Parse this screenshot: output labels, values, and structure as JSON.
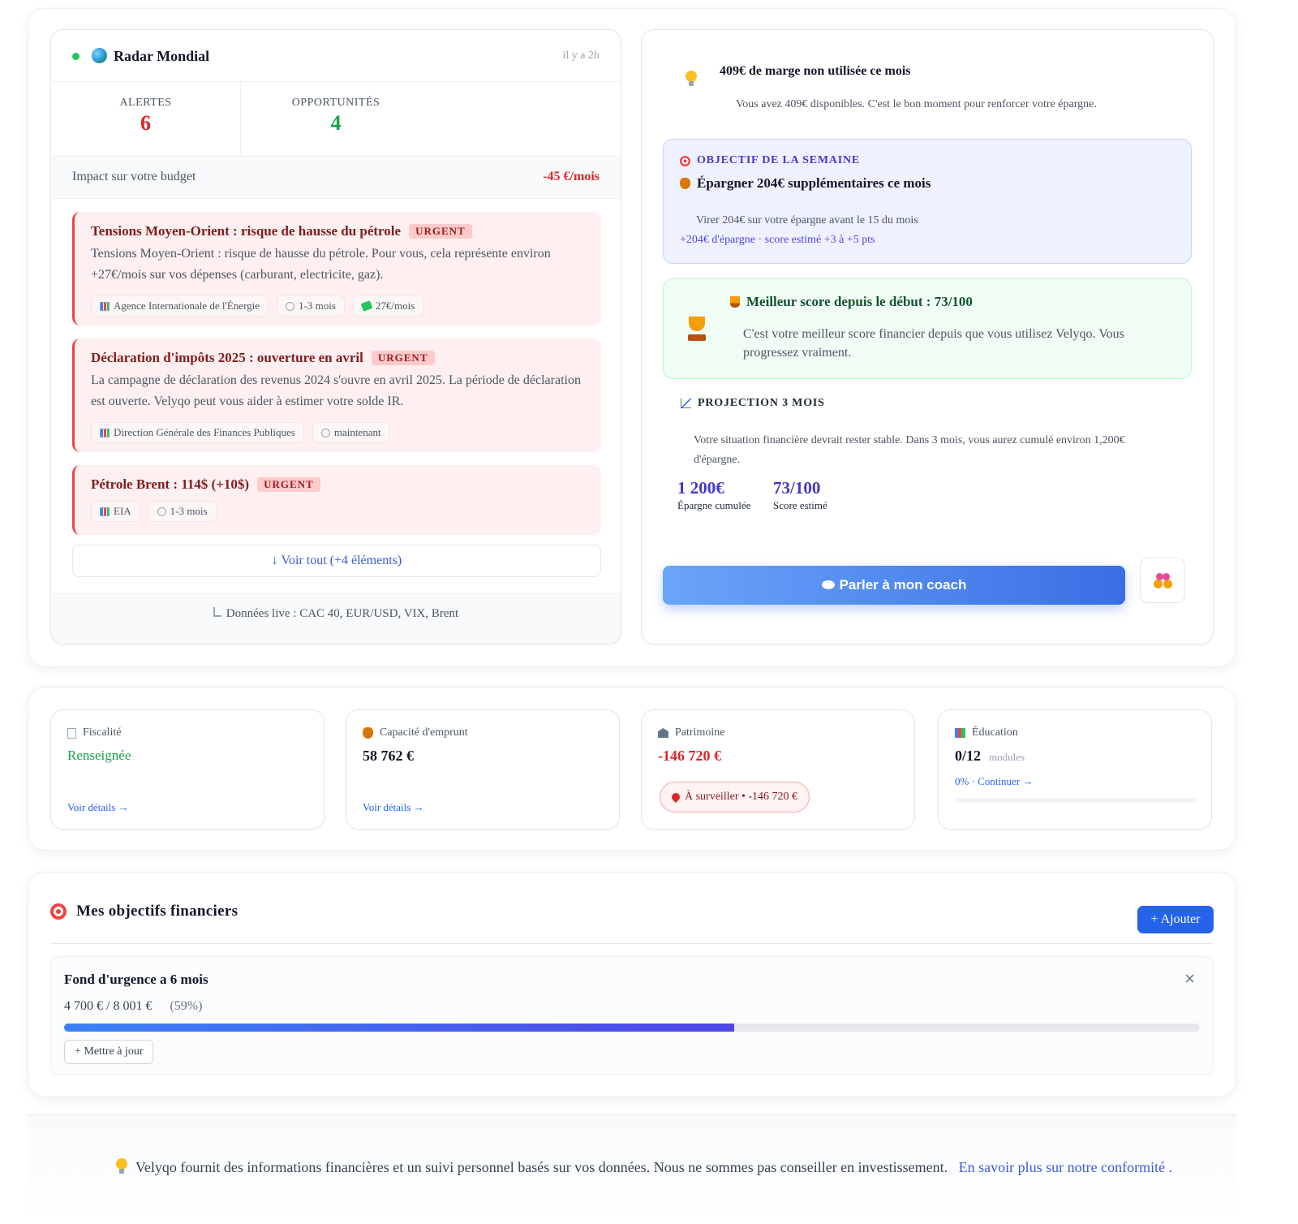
{
  "radar": {
    "title": "Radar Mondial",
    "time": "il y a 2h",
    "alerts_label": "ALERTES",
    "alerts_count": "6",
    "opps_label": "OPPORTUNITÉS",
    "opps_count": "4",
    "impact_label": "Impact sur votre budget",
    "impact_value": "-45 €/mois",
    "items": [
      {
        "title": "Tensions Moyen-Orient : risque de hausse du pétrole",
        "badge": "URGENT",
        "text": "Tensions Moyen-Orient : risque de hausse du pétrole. Pour vous, cela représente environ +27€/mois sur vos dépenses (carburant, electricite, gaz).",
        "source": "Agence Internationale de l'Énergie",
        "horizon": "1-3 mois",
        "amount": "27€/mois"
      },
      {
        "title": "Déclaration d'impôts 2025 : ouverture en avril",
        "badge": "URGENT",
        "text": "La campagne de déclaration des revenus 2024 s'ouvre en avril 2025. La période de déclaration est ouverte. Velyqo peut vous aider à estimer votre solde IR.",
        "source": "Direction Générale des Finances Publiques",
        "horizon": "maintenant"
      },
      {
        "title": "Pétrole Brent : 114$ (+10$)",
        "badge": "URGENT",
        "source": "EIA",
        "horizon": "1-3 mois"
      }
    ],
    "see_all": "↓ Voir tout (+4 éléments)",
    "live": "Données live : CAC 40, EUR/USD, VIX, Brent"
  },
  "coach": {
    "marge_title": "409€ de marge non utilisée ce mois",
    "marge_text": "Vous avez 409€ disponibles. C'est le bon moment pour renforcer votre épargne.",
    "objective_label": "OBJECTIF DE LA SEMAINE",
    "objective_title": "Épargner 204€ supplémentaires ce mois",
    "objective_text": "Virer 204€ sur votre épargne avant le 15 du mois",
    "objective_sub": "+204€ d'épargne · score estimé +3 à +5 pts",
    "best_title": "Meilleur score depuis le début : 73/100",
    "best_text": "C'est votre meilleur score financier depuis que vous utilisez Velyqo. Vous progressez vraiment.",
    "projection_label": "PROJECTION 3 MOIS",
    "projection_text": "Votre situation financière devrait rester stable. Dans 3 mois, vous aurez cumulé environ 1,200€ d'épargne.",
    "savings_value": "1 200€",
    "savings_label": "Épargne cumulée",
    "score_value": "73/100",
    "score_label": "Score estimé",
    "button_label": "Parler à mon coach"
  },
  "summary": {
    "fiscal_label": "Fiscalité",
    "fiscal_value": "Renseignée",
    "fiscal_link": "Voir détails →",
    "borrow_label": "Capacité d'emprunt",
    "borrow_value": "58 762 €",
    "borrow_link": "Voir détails →",
    "wealth_label": "Patrimoine",
    "wealth_value": "-146 720 €",
    "wealth_badge": "À surveiller • -146 720 €",
    "edu_label": "Éducation",
    "edu_value": "0/12",
    "edu_unit": "modules",
    "edu_link": "0% · Continuer →",
    "edu_progress": 0
  },
  "goals": {
    "title": "Mes objectifs financiers",
    "add_label": "+ Ajouter",
    "items": [
      {
        "name": "Fond d'urgence a 6 mois",
        "amount": "4 700 € / 8 001 €",
        "percent_text": "(59%)",
        "progress": 0.59,
        "update_label": "+ Mettre à jour",
        "close": "×"
      }
    ]
  },
  "footer": {
    "text": "Velyqo fournit des informations financières et un suivi personnel basés sur vos données. Nous ne sommes pas conseiller en investissement.",
    "link": "En savoir plus sur notre conformité",
    "end": "."
  },
  "colors": {
    "accent": "#2563eb",
    "alert_red": "#dc2626",
    "success_green": "#16a34a",
    "indigo": "#4338ca"
  }
}
